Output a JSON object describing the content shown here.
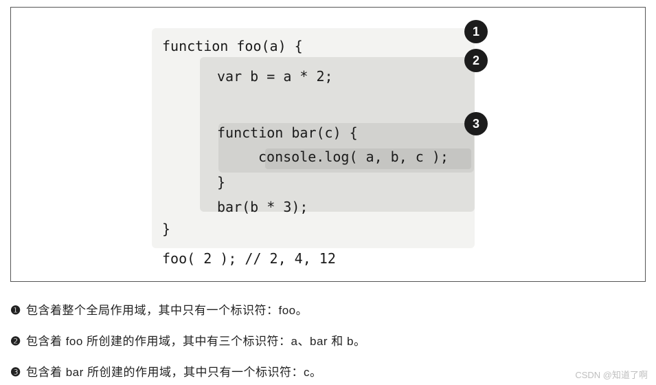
{
  "badges": {
    "b1": "1",
    "b2": "2",
    "b3": "3"
  },
  "code": {
    "line1": "function foo(a) {",
    "line2": "var b = a * 2;",
    "line3": "",
    "line4": "function bar(c) {",
    "line5": "console.log( a, b, c );",
    "line6": "}",
    "line7": "bar(b * 3);",
    "line8": "}",
    "line9": "foo( 2 ); // 2, 4, 12"
  },
  "explanations": {
    "item1_bullet": "❶",
    "item1_text": " 包含着整个全局作用域，其中只有一个标识符：foo。",
    "item2_bullet": "❷",
    "item2_text": " 包含着 foo 所创建的作用域，其中有三个标识符：a、bar 和 b。",
    "item3_bullet": "❸",
    "item3_text": " 包含着 bar 所创建的作用域，其中只有一个标识符：c。"
  },
  "watermark": "CSDN @知道了啊"
}
